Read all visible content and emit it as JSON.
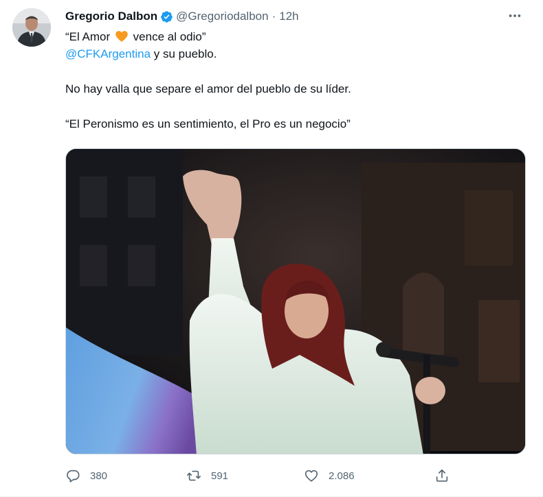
{
  "tweet": {
    "display_name": "Gregorio Dalbon",
    "handle": "@Gregoriodalbon",
    "separator": "·",
    "time": "12h",
    "line1_pre": "“El Amor",
    "line1_post": "vence al odio”",
    "mention": "@CFKArgentina",
    "line2_post": " y su pueblo.",
    "line3": "No hay valla que separe el amor del pueblo de su líder.",
    "line4": "“El Peronismo es un sentimiento, el Pro es un negocio”"
  },
  "actions": {
    "replies": "380",
    "retweets": "591",
    "likes": "2.086"
  },
  "icons": {
    "verified": "verified-badge-icon",
    "heart_emoji": "orange-heart-icon",
    "more": "more-dots-icon",
    "reply": "reply-icon",
    "retweet": "retweet-icon",
    "like": "like-heart-icon",
    "share": "share-icon"
  },
  "colors": {
    "accent": "#1d9bf0",
    "text": "#0f1419",
    "muted": "#536471",
    "heart": "#f79a1e"
  }
}
